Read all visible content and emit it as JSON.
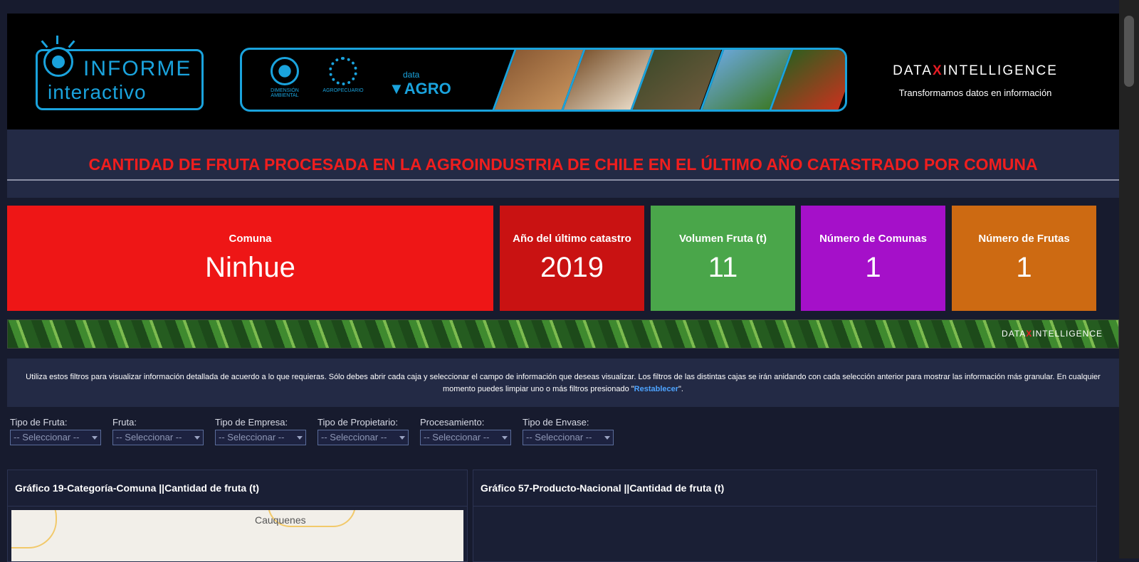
{
  "header": {
    "logo_line1": "INFORME",
    "logo_line2": "interactivo",
    "ministry1": "DIMENSIÓN AMBIENTAL",
    "ministry2": "AGROPECUARIO",
    "dataagro_small": "data",
    "dataagro_big": "AGRO",
    "brand_left": "DATA",
    "brand_x": "X",
    "brand_right": "INTELLIGENCE",
    "tagline": "Transformamos datos en información"
  },
  "title": "CANTIDAD DE FRUTA PROCESADA EN LA AGROINDUSTRIA DE CHILE EN EL ÚLTIMO AÑO CATASTRADO POR COMUNA",
  "kpis": [
    {
      "label": "Comuna",
      "value": "Ninhue",
      "color": "#ee1616"
    },
    {
      "label": "Año del último catastro",
      "value": "2019",
      "color": "#c91212"
    },
    {
      "label": "Volumen Fruta (t)",
      "value": "11",
      "color": "#4aa64a"
    },
    {
      "label": "Número de Comunas",
      "value": "1",
      "color": "#a510c9"
    },
    {
      "label": "Número de Frutas",
      "value": "1",
      "color": "#cd6a12"
    }
  ],
  "info": {
    "text": "Utiliza estos filtros para visualizar información detallada de acuerdo a lo que requieras. Sólo debes abrir cada caja y seleccionar el campo de información que deseas visualizar. Los filtros de las distintas cajas se irán anidando con cada selección anterior para mostrar las información más granular. En cualquier momento puedes limpiar uno o más filtros presionado \"",
    "link": "Restablecer",
    "suffix": "\"."
  },
  "filters": [
    {
      "label": "Tipo de Fruta:",
      "value": "-- Seleccionar --"
    },
    {
      "label": "Fruta:",
      "value": "-- Seleccionar --"
    },
    {
      "label": "Tipo de Empresa:",
      "value": "-- Seleccionar --"
    },
    {
      "label": "Tipo de Propietario:",
      "value": "-- Seleccionar --"
    },
    {
      "label": "Procesamiento:",
      "value": "-- Seleccionar --"
    },
    {
      "label": "Tipo de Envase:",
      "value": "-- Seleccionar --"
    }
  ],
  "panels": [
    {
      "title": "Gráfico 19-Categoría-Comuna ||Cantidad de fruta (t)",
      "map_label": "Cauquenes"
    },
    {
      "title": "Gráfico 57-Producto-Nacional ||Cantidad de fruta (t)"
    }
  ]
}
